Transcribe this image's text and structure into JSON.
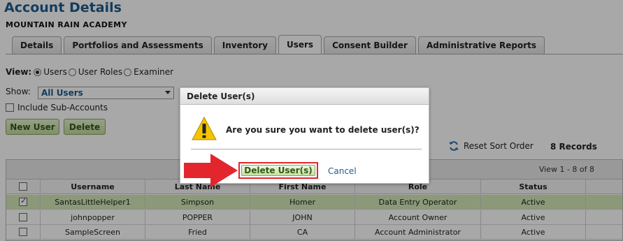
{
  "header": {
    "title": "Account Details",
    "subtitle": "MOUNTAIN RAIN ACADEMY"
  },
  "tabs": [
    {
      "label": "Details",
      "active": false
    },
    {
      "label": "Portfolios and Assessments",
      "active": false
    },
    {
      "label": "Inventory",
      "active": false
    },
    {
      "label": "Users",
      "active": true
    },
    {
      "label": "Consent Builder",
      "active": false
    },
    {
      "label": "Administrative Reports",
      "active": false
    }
  ],
  "view": {
    "label": "View:",
    "options": [
      {
        "label": "Users",
        "checked": true
      },
      {
        "label": "User Roles",
        "checked": false
      },
      {
        "label": "Examiner",
        "checked": false
      }
    ]
  },
  "show": {
    "label": "Show:",
    "selected": "All Users"
  },
  "include_sub_accounts": {
    "label": "Include Sub-Accounts",
    "checked": false
  },
  "buttons": {
    "new_user": "New User",
    "delete": "Delete"
  },
  "toolbar": {
    "reset_sort": "Reset Sort Order",
    "records": "8 Records",
    "view_info": "View 1 - 8 of 8"
  },
  "table": {
    "columns": [
      "",
      "Username",
      "Last Name",
      "First Name",
      "Role",
      "Status"
    ],
    "rows": [
      {
        "checked": true,
        "username": "SantasLittleHelper1",
        "last_name": "Simpson",
        "first_name": "Homer",
        "role": "Data Entry Operator",
        "status": "Active"
      },
      {
        "checked": false,
        "username": "johnpopper",
        "last_name": "POPPER",
        "first_name": "JOHN",
        "role": "Account Owner",
        "status": "Active"
      },
      {
        "checked": false,
        "username": "SampleScreen",
        "last_name": "Fried",
        "first_name": "CA",
        "role": "Account Administrator",
        "status": "Active"
      }
    ]
  },
  "dialog": {
    "title": "Delete User(s)",
    "message": "Are you sure you want to delete user(s)?",
    "confirm_label": "Delete User(s)",
    "cancel_label": "Cancel"
  },
  "icons": {
    "warning": "warning-icon",
    "reset": "refresh-icon",
    "pointer": "red-arrow-icon"
  },
  "colors": {
    "title_blue": "#1d5c8e",
    "button_green": "#c3da9f",
    "highlight_red": "#e3262d",
    "selected_row": "#d4e8b6"
  }
}
